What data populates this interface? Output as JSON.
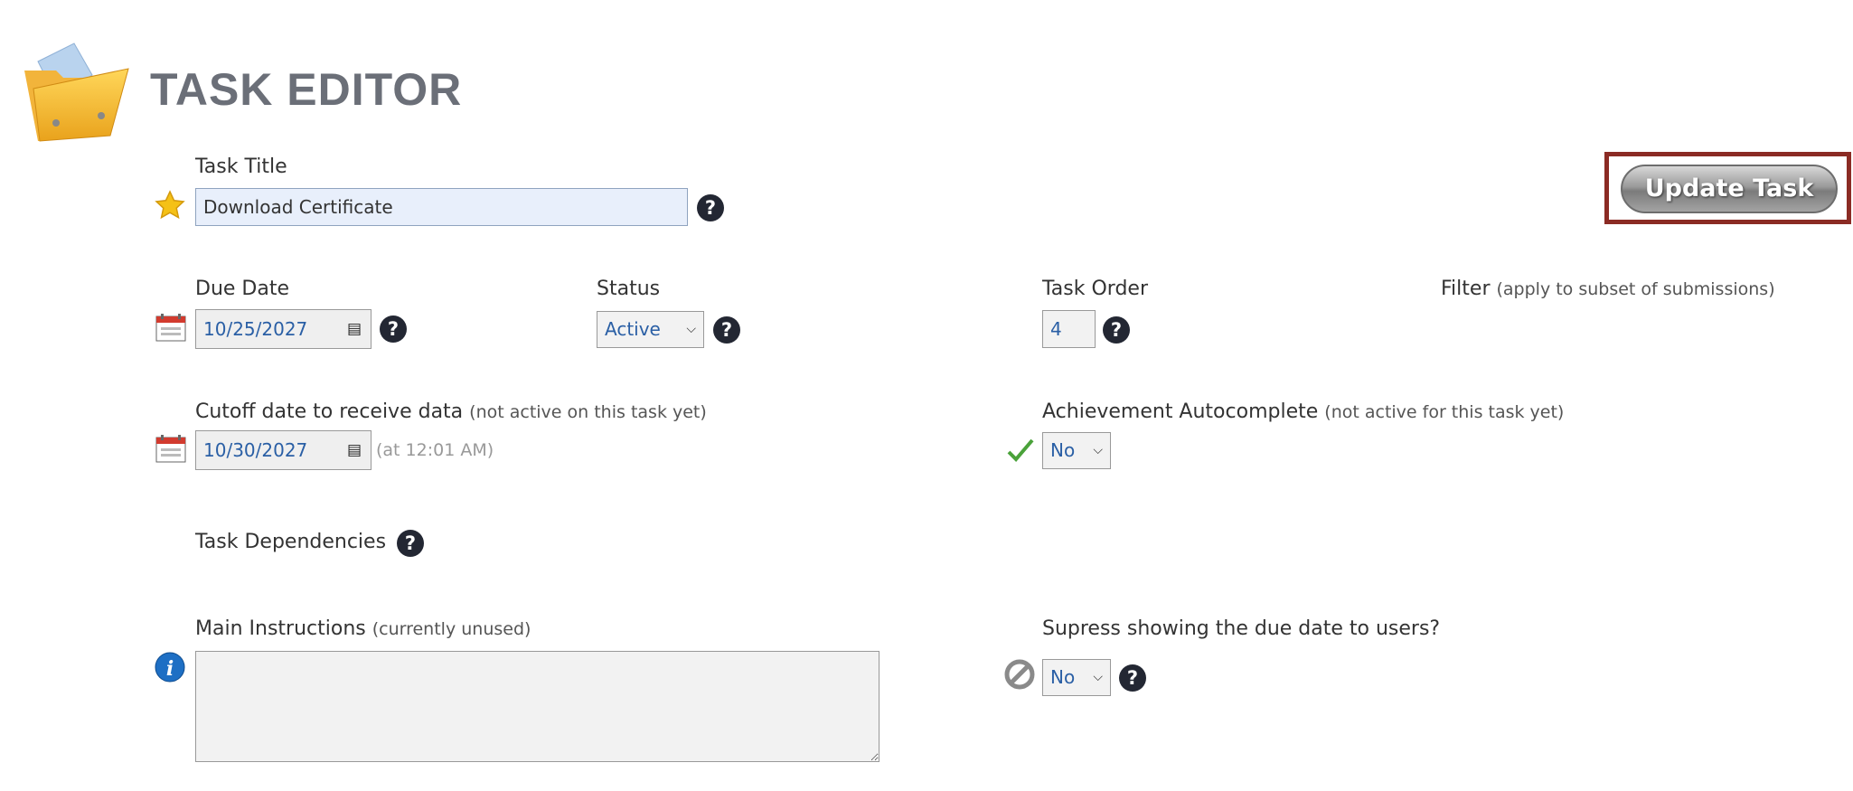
{
  "header": {
    "title": "TASK EDITOR"
  },
  "task_title": {
    "label": "Task Title",
    "value": "Download Certificate"
  },
  "update_button": {
    "label": "Update Task"
  },
  "due_date": {
    "label": "Due Date",
    "value": "10/25/2027"
  },
  "status": {
    "label": "Status",
    "value": "Active"
  },
  "task_order": {
    "label": "Task Order",
    "value": "4"
  },
  "filter": {
    "label": "Filter",
    "note": "(apply to subset of submissions)"
  },
  "cutoff": {
    "label": "Cutoff date to receive data",
    "note": "(not active on this task yet)",
    "value": "10/30/2027",
    "time_note": "(at 12:01 AM)"
  },
  "achievement": {
    "label": "Achievement Autocomplete",
    "note": "(not active for this task yet)",
    "value": "No"
  },
  "dependencies": {
    "label": "Task Dependencies"
  },
  "instructions": {
    "label": "Main Instructions",
    "note": "(currently unused)"
  },
  "suppress": {
    "label": "Supress showing the due date to users?",
    "value": "No"
  },
  "help_glyph": "?"
}
